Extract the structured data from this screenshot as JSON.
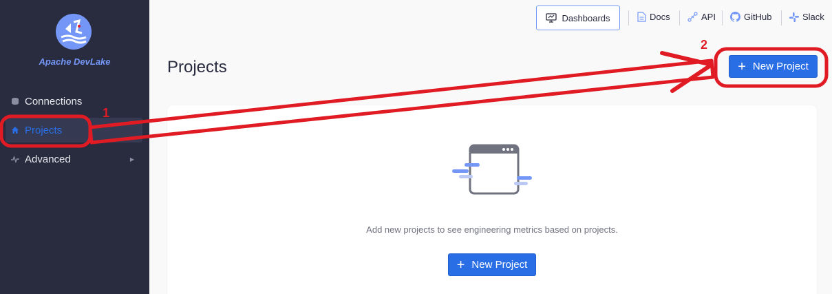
{
  "sidebar": {
    "brand": "Apache DevLake",
    "items": [
      {
        "label": "Connections",
        "icon": "database-icon"
      },
      {
        "label": "Projects",
        "icon": "home-icon",
        "active": true
      },
      {
        "label": "Advanced",
        "icon": "pulse-icon",
        "has_submenu": true
      }
    ]
  },
  "header": {
    "dashboards_label": "Dashboards",
    "links": [
      {
        "label": "Docs",
        "icon": "document-icon"
      },
      {
        "label": "API",
        "icon": "api-icon"
      },
      {
        "label": "GitHub",
        "icon": "github-icon"
      },
      {
        "label": "Slack",
        "icon": "slack-icon"
      }
    ]
  },
  "main": {
    "title": "Projects",
    "new_project_label": "New Project",
    "empty_message": "Add new projects to see engineering metrics based on projects.",
    "empty_button_label": "New Project"
  },
  "annotations": {
    "step1": "1",
    "step2": "2"
  },
  "colors": {
    "sidebar_bg": "#292b3f",
    "accent": "#2a6ee5",
    "annotation": "#e01b24"
  }
}
